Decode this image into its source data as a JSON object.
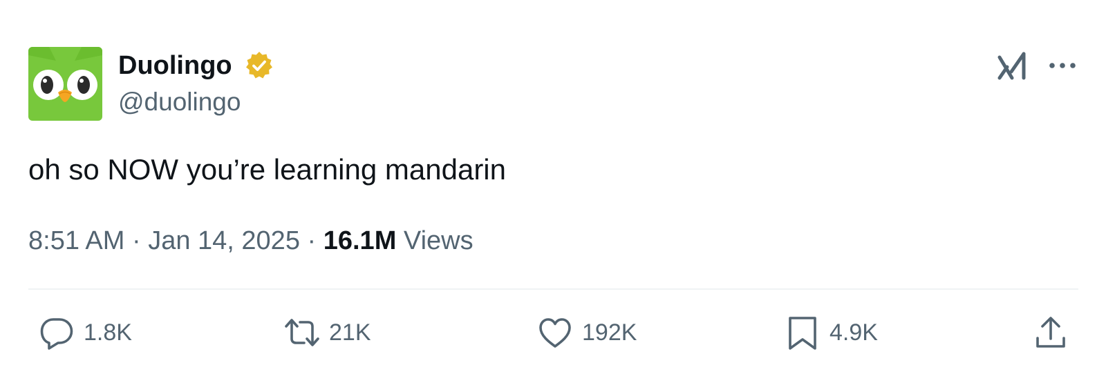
{
  "author": {
    "display_name": "Duolingo",
    "handle": "@duolingo",
    "verified": true,
    "avatar_icon": "duolingo-owl-icon",
    "avatar_color": "#78c83c",
    "verified_badge_color": "#e8b829"
  },
  "header_actions": {
    "grok_icon": "grok-icon",
    "more_icon": "more-icon"
  },
  "tweet": {
    "text": "oh so NOW you’re learning mandarin",
    "time": "8:51 AM",
    "date": "Jan 14, 2025",
    "separator": "·",
    "views_count": "16.1M",
    "views_label": "Views"
  },
  "actions": [
    {
      "icon": "reply-icon",
      "count": "1.8K"
    },
    {
      "icon": "retweet-icon",
      "count": "21K"
    },
    {
      "icon": "like-icon",
      "count": "192K"
    },
    {
      "icon": "bookmark-icon",
      "count": "4.9K"
    },
    {
      "icon": "share-icon",
      "count": ""
    }
  ],
  "colors": {
    "text_primary": "#0f1419",
    "text_secondary": "#536471",
    "divider": "#eff3f4"
  }
}
